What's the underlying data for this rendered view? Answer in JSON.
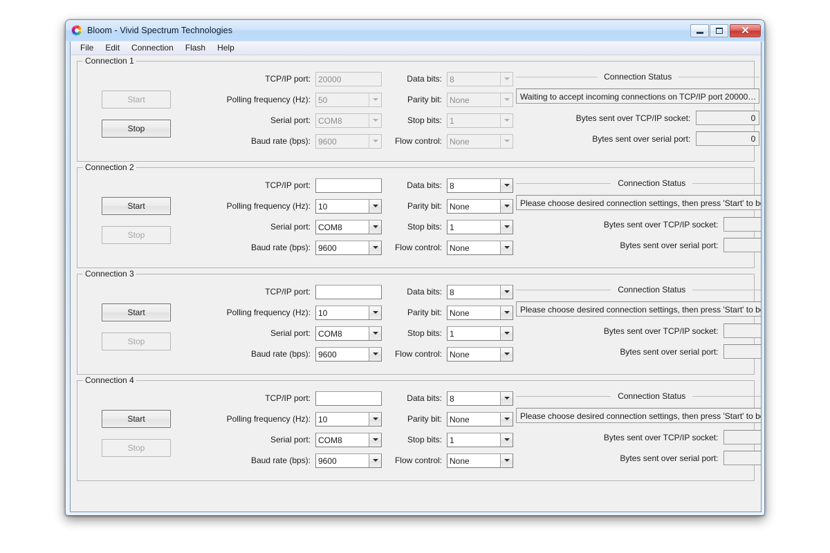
{
  "window": {
    "title": "Bloom - Vivid Spectrum Technologies",
    "icon": "color-wheel-icon",
    "caption_buttons": {
      "minimize": "minimize-icon",
      "maximize": "maximize-icon",
      "close": "✕"
    },
    "accent_title_color": "#bedbf9",
    "close_color": "#c93a33",
    "client_color": "#f0f0f0"
  },
  "menubar": {
    "items": [
      {
        "label": "File"
      },
      {
        "label": "Edit"
      },
      {
        "label": "Connection"
      },
      {
        "label": "Flash"
      },
      {
        "label": "Help"
      }
    ]
  },
  "labels": {
    "tcp_port": "TCP/IP port:",
    "polling": "Polling frequency (Hz):",
    "serial_port": "Serial port:",
    "baud_rate": "Baud rate (bps):",
    "data_bits": "Data bits:",
    "parity_bit": "Parity bit:",
    "stop_bits": "Stop bits:",
    "flow_control": "Flow control:",
    "status_title": "Connection Status",
    "bytes_tcp": "Bytes sent over TCP/IP socket:",
    "bytes_serial": "Bytes sent over serial port:",
    "start": "Start",
    "stop": "Stop"
  },
  "placeholders": {
    "tcp_port": ""
  },
  "connections": [
    {
      "legend": "Connection 1",
      "running": true,
      "start_enabled": false,
      "stop_enabled": true,
      "fields": {
        "tcp_port": "20000",
        "polling": "50",
        "serial_port": "COM8",
        "baud_rate": "9600",
        "data_bits": "8",
        "parity_bit": "None",
        "stop_bits": "1",
        "flow_control": "None"
      },
      "status": {
        "message": "Waiting to accept incoming connections on TCP/IP port 20000…",
        "bytes_tcp": "0",
        "bytes_serial": "0"
      }
    },
    {
      "legend": "Connection 2",
      "running": false,
      "start_enabled": true,
      "stop_enabled": false,
      "fields": {
        "tcp_port": "",
        "polling": "10",
        "serial_port": "COM8",
        "baud_rate": "9600",
        "data_bits": "8",
        "parity_bit": "None",
        "stop_bits": "1",
        "flow_control": "None"
      },
      "status": {
        "message": "Please choose desired connection settings, then press 'Start' to begin…",
        "bytes_tcp": "",
        "bytes_serial": ""
      }
    },
    {
      "legend": "Connection 3",
      "running": false,
      "start_enabled": true,
      "stop_enabled": false,
      "fields": {
        "tcp_port": "",
        "polling": "10",
        "serial_port": "COM8",
        "baud_rate": "9600",
        "data_bits": "8",
        "parity_bit": "None",
        "stop_bits": "1",
        "flow_control": "None"
      },
      "status": {
        "message": "Please choose desired connection settings, then press 'Start' to begin…",
        "bytes_tcp": "",
        "bytes_serial": ""
      }
    },
    {
      "legend": "Connection 4",
      "running": false,
      "start_enabled": true,
      "stop_enabled": false,
      "fields": {
        "tcp_port": "",
        "polling": "10",
        "serial_port": "COM8",
        "baud_rate": "9600",
        "data_bits": "8",
        "parity_bit": "None",
        "stop_bits": "1",
        "flow_control": "None"
      },
      "status": {
        "message": "Please choose desired connection settings, then press 'Start' to begin…",
        "bytes_tcp": "",
        "bytes_serial": ""
      }
    }
  ]
}
